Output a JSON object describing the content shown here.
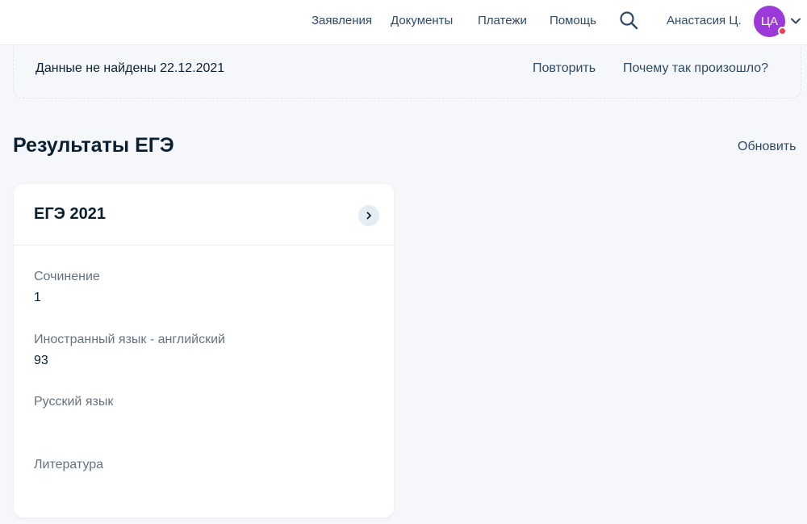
{
  "header": {
    "nav": [
      {
        "label": "Заявления"
      },
      {
        "label": "Документы"
      },
      {
        "label": "Платежи"
      },
      {
        "label": "Помощь"
      }
    ],
    "search_icon": "search-icon",
    "user_name": "Анастасия Ц.",
    "avatar_initials": "ЦА",
    "avatar_color": "#9b3ad9",
    "notification_dot_color": "#ee3f58"
  },
  "error_banner": {
    "message": "Данные не найдены 22.12.2021",
    "retry_label": "Повторить",
    "why_label": "Почему так произошло?"
  },
  "section": {
    "title": "Результаты ЕГЭ",
    "refresh_label": "Обновить"
  },
  "card": {
    "title": "ЕГЭ 2021",
    "subjects": [
      {
        "name": "Сочинение",
        "score": "1"
      },
      {
        "name": "Иностранный язык - английский",
        "score": "93"
      },
      {
        "name": "Русский язык",
        "score": ""
      },
      {
        "name": "Литература",
        "score": ""
      }
    ]
  },
  "colors": {
    "background": "#f5f7fa",
    "link": "#2f4a66",
    "text": "#0b1f33",
    "muted": "#66727f"
  }
}
